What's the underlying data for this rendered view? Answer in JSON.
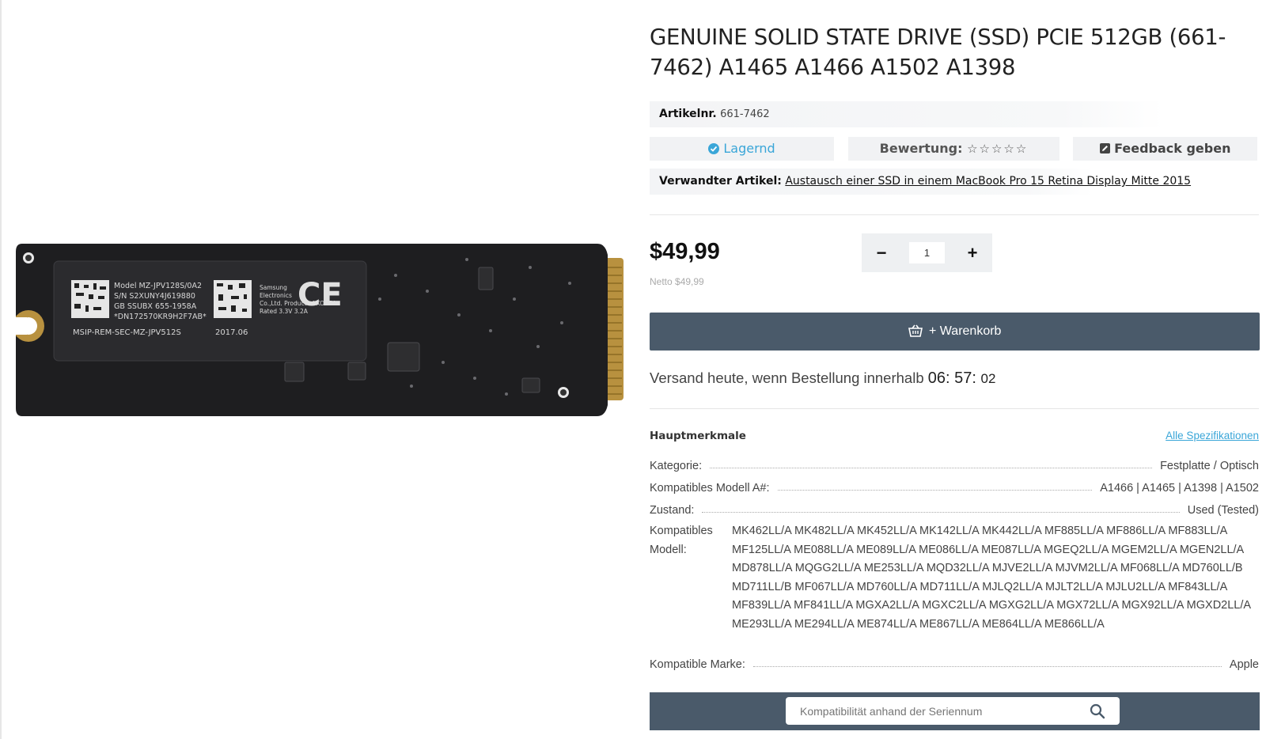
{
  "product": {
    "title": "GENUINE SOLID STATE DRIVE (SSD) PCIE 512GB (661-7462) A1465 A1466 A1502 A1398",
    "image_alt": "Samsung PCIe SSD module",
    "label_lines": [
      "Model  MZ-JPV128S/0A2",
      "S/N  S2XUNY4J619880",
      "GB SSUBX  655-1958A",
      "*DN172570KR9H2F7AB*",
      "MSIP-REM-SEC-MZ-JPV512S",
      "2017.06",
      "Samsung Electronics",
      "Co.,Ltd.  Product of KOREA",
      "Rated 3.3V  3.2A"
    ]
  },
  "sku": {
    "label": "Artikelnr.",
    "value": "661-7462"
  },
  "status": {
    "stock": "Lagernd",
    "rating_label": "Bewertung:",
    "rating_stars": "☆☆☆☆☆",
    "feedback": "Feedback geben"
  },
  "related": {
    "label": "Verwandter Artikel:",
    "link": "Austausch einer SSD in einem MacBook Pro 15 Retina Display Mitte 2015"
  },
  "pricing": {
    "price": "$49,99",
    "netto": "Netto $49,99",
    "qty_minus": "−",
    "qty_plus": "+",
    "qty_value": "1"
  },
  "cart": {
    "label": "+ Warenkorb"
  },
  "shipping": {
    "text": "Versand heute, wenn Bestellung innerhalb",
    "hours": "06",
    "minutes": "57",
    "seconds": "02"
  },
  "specs": {
    "title": "Hauptmerkmale",
    "all_link": "Alle Spezifikationen",
    "rows": [
      {
        "key": "Kategorie:",
        "value": "Festplatte / Optisch"
      },
      {
        "key": "Kompatibles Modell A#:",
        "value": "A1466 | A1465 | A1398 | A1502"
      },
      {
        "key": "Zustand:",
        "value": "Used (Tested)"
      }
    ],
    "compat_key": "Kompatibles Modell:",
    "compat_value": "MK462LL/A MK482LL/A MK452LL/A MK142LL/A MK442LL/A MF885LL/A MF886LL/A MF883LL/A MF125LL/A ME088LL/A ME089LL/A ME086LL/A ME087LL/A MGEQ2LL/A MGEM2LL/A MGEN2LL/A MD878LL/A MQGG2LL/A ME253LL/A MQD32LL/A MJVE2LL/A MJVM2LL/A MF068LL/A MD760LL/B MD711LL/B MF067LL/A MD760LL/A MD711LL/A MJLQ2LL/A MJLT2LL/A MJLU2LL/A MF843LL/A MF839LL/A MF841LL/A MGXA2LL/A MGXC2LL/A MGXG2LL/A MGX72LL/A MGX92LL/A MGXD2LL/A ME293LL/A ME294LL/A ME874LL/A ME867LL/A ME864LL/A ME866LL/A",
    "brand_key": "Kompatible Marke:",
    "brand_value": "Apple"
  },
  "search": {
    "placeholder": "Kompatibilität anhand der Seriennum"
  },
  "colors": {
    "accent": "#3aa6d8",
    "button": "#4a5a6a"
  }
}
